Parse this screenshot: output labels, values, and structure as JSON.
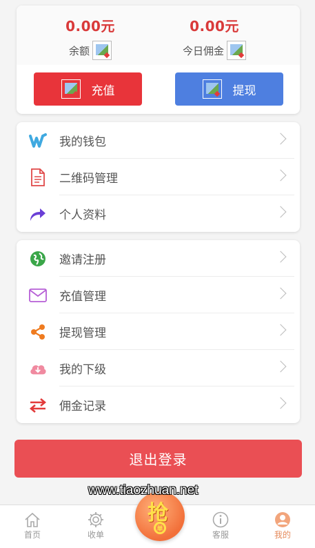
{
  "balance": {
    "amount": "0.00元",
    "label": "余额",
    "commission_amount": "0.00元",
    "commission_label": "今日佣金"
  },
  "actions": {
    "recharge": "充值",
    "withdraw": "提现"
  },
  "menu1": [
    {
      "label": "我的钱包",
      "icon": "wallet-icon"
    },
    {
      "label": "二维码管理",
      "icon": "document-icon"
    },
    {
      "label": "个人资料",
      "icon": "share-arrow-icon"
    }
  ],
  "menu2": [
    {
      "label": "邀请注册",
      "icon": "globe-icon"
    },
    {
      "label": "充值管理",
      "icon": "envelope-icon"
    },
    {
      "label": "提现管理",
      "icon": "share-nodes-icon"
    },
    {
      "label": "我的下级",
      "icon": "cloud-download-icon"
    },
    {
      "label": "佣金记录",
      "icon": "transfer-arrows-icon"
    }
  ],
  "logout": "退出登录",
  "watermark": "www.tiaozhuan.net",
  "tabbar": {
    "home": "首页",
    "orders": "收单",
    "grab": "抢",
    "grab_sub": "单",
    "service": "客服",
    "mine": "我的"
  },
  "colors": {
    "amount": "#d93a3a",
    "recharge_button": "#e8343a",
    "withdraw_button": "#4e7fe0",
    "logout_button": "#ea4f54",
    "active_tab": "#e58a5b"
  }
}
